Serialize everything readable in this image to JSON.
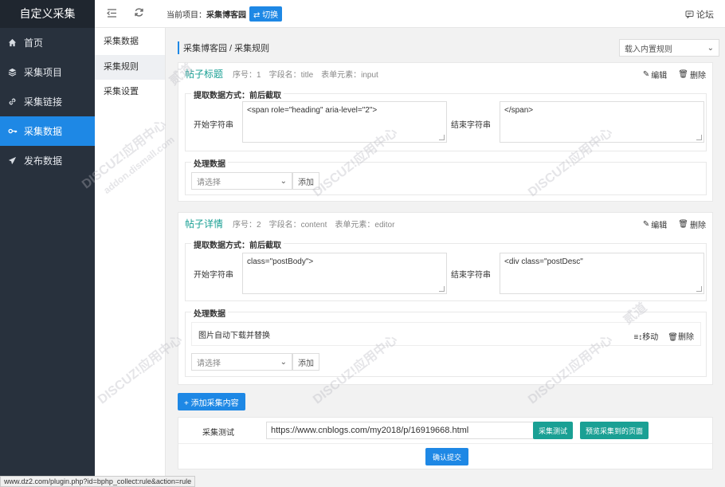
{
  "sidebar": {
    "brand": "自定义采集",
    "items": [
      {
        "icon": "home-icon",
        "label": "首页"
      },
      {
        "icon": "layers-icon",
        "label": "采集项目"
      },
      {
        "icon": "link-icon",
        "label": "采集链接"
      },
      {
        "icon": "key-icon",
        "label": "采集数据"
      },
      {
        "icon": "send-icon",
        "label": "发布数据"
      }
    ]
  },
  "subsidebar": {
    "header": "采集数据",
    "items": [
      "采集规则",
      "采集设置"
    ]
  },
  "topbar": {
    "project_prefix": "当前项目：",
    "project_name": "采集博客园",
    "switch_label": "切换",
    "forum_label": "论坛"
  },
  "main": {
    "breadcrumb": "采集博客园 / 采集规则",
    "load_rule_select": "载入内置规则",
    "cards": [
      {
        "title": "帖子标题",
        "seq": "序号：1",
        "field": "字段名：title",
        "element": "表单元素：input",
        "edit": "编辑",
        "delete": "删除",
        "extract_label": "提取数据方式：前后截取",
        "start_label": "开始字符串",
        "start_value": "<span role=\"heading\" aria-level=\"2\">",
        "end_label": "结束字符串",
        "end_value": "</span>",
        "process_label": "处理数据",
        "select_placeholder": "请选择",
        "add_label": "添加"
      },
      {
        "title": "帖子详情",
        "seq": "序号：2",
        "field": "字段名：content",
        "element": "表单元素：editor",
        "edit": "编辑",
        "delete": "删除",
        "extract_label": "提取数据方式：前后截取",
        "start_label": "开始字符串",
        "start_value": "class=\"postBody\">",
        "end_label": "结束字符串",
        "end_value": "<div class=\"postDesc\"",
        "process_label": "处理数据",
        "step_name": "图片自动下载并替换",
        "step_move": "移动",
        "step_delete": "删除",
        "select_placeholder": "请选择",
        "add_label": "添加"
      }
    ],
    "add_content_label": "+ 添加采集内容",
    "test": {
      "label": "采集测试",
      "url": "https://www.cnblogs.com/my2018/p/16919668.html",
      "test_button": "采集测试",
      "preview_button": "预览采集到的页面",
      "submit_button": "确认提交"
    }
  },
  "status_url": "www.dz2.com/plugin.php?id=bphp_collect:rule&action=rule",
  "watermark": {
    "line1": "DISCUZ!应用中心",
    "line2": "addon.dismall.com",
    "line3": "贰道"
  },
  "colors": {
    "accent": "#1e88e5",
    "teal": "#1aa094",
    "sidebar": "#28313d"
  }
}
